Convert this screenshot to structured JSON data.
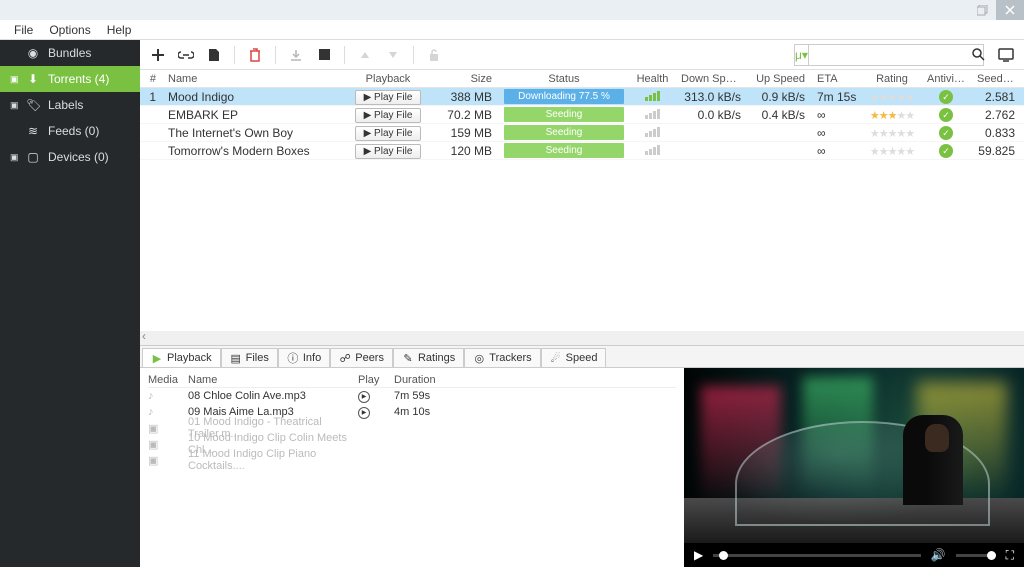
{
  "menubar": [
    "File",
    "Options",
    "Help"
  ],
  "sidebar": {
    "items": [
      {
        "icon": "globe",
        "label": "Bundles",
        "expandable": false
      },
      {
        "icon": "download",
        "label": "Torrents (4)",
        "active": true,
        "expandable": true
      },
      {
        "icon": "tag",
        "label": "Labels",
        "expandable": true
      },
      {
        "icon": "rss",
        "label": "Feeds (0)",
        "expandable": false
      },
      {
        "icon": "device",
        "label": "Devices (0)",
        "expandable": true
      }
    ]
  },
  "toolbar": {
    "search_placeholder": ""
  },
  "columns": {
    "num": "#",
    "name": "Name",
    "play": "Playback",
    "size": "Size",
    "status": "Status",
    "health": "Health",
    "down": "Down Speed",
    "up": "Up Speed",
    "eta": "ETA",
    "rating": "Rating",
    "av": "Antivirus",
    "seeds": "Seeds/..."
  },
  "play_label": "Play File",
  "torrents": [
    {
      "num": "1",
      "name": "Mood Indigo",
      "size": "388 MB",
      "status": "Downloading 77.5 %",
      "downloading": true,
      "health_on": true,
      "down": "313.0 kB/s",
      "up": "0.9 kB/s",
      "eta": "7m 15s",
      "rating": 0,
      "av": true,
      "seeds": "2.581",
      "selected": true
    },
    {
      "num": "",
      "name": "EMBARK EP",
      "size": "70.2 MB",
      "status": "Seeding",
      "health_on": false,
      "down": "0.0 kB/s",
      "up": "0.4 kB/s",
      "eta": "∞",
      "rating": 3,
      "av": true,
      "seeds": "2.762"
    },
    {
      "num": "",
      "name": "The Internet's Own Boy",
      "size": "159 MB",
      "status": "Seeding",
      "health_on": false,
      "down": "",
      "up": "",
      "eta": "∞",
      "rating": 0,
      "av": true,
      "seeds": "0.833"
    },
    {
      "num": "",
      "name": "Tomorrow's Modern Boxes",
      "size": "120 MB",
      "status": "Seeding",
      "health_on": false,
      "down": "",
      "up": "",
      "eta": "∞",
      "rating": 0,
      "av": true,
      "seeds": "59.825"
    }
  ],
  "tabs": [
    "Playback",
    "Files",
    "Info",
    "Peers",
    "Ratings",
    "Trackers",
    "Speed"
  ],
  "filecols": {
    "media": "Media",
    "name": "Name",
    "play": "Play",
    "dur": "Duration"
  },
  "files": [
    {
      "type": "audio",
      "name": "08 Chloe Colin Ave.mp3",
      "playable": true,
      "dur": "7m 59s"
    },
    {
      "type": "audio",
      "name": "09 Mais Aime La.mp3",
      "playable": true,
      "dur": "4m 10s"
    },
    {
      "type": "video",
      "name": "01 Mood Indigo - Theatrical Trailer.m...",
      "playable": false,
      "dur": ""
    },
    {
      "type": "video",
      "name": "10 Mood Indigo Clip Colin Meets Chl...",
      "playable": false,
      "dur": ""
    },
    {
      "type": "video",
      "name": "11 Mood Indigo Clip Piano Cocktails....",
      "playable": false,
      "dur": ""
    }
  ]
}
